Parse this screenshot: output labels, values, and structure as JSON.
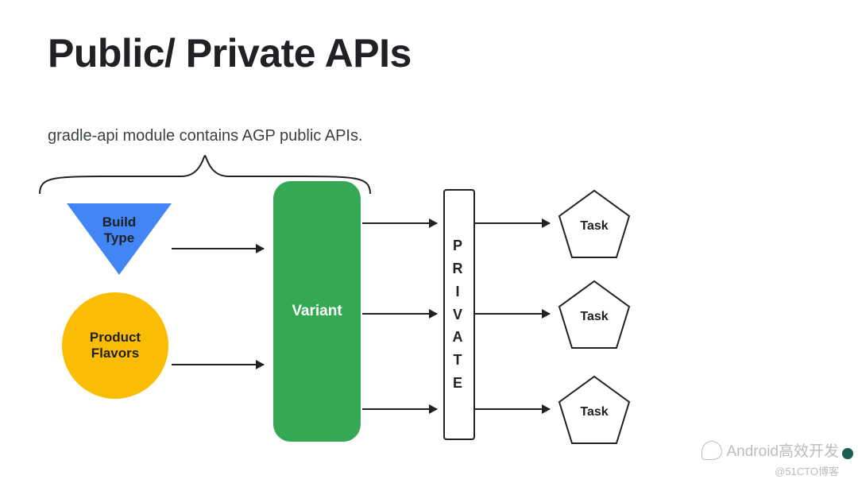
{
  "title": "Public/ Private APIs",
  "subtitle": "gradle-api module contains AGP public APIs.",
  "shapes": {
    "build_type": "Build\nType",
    "product_flavors": "Product\nFlavors",
    "variant": "Variant",
    "private": "PRIVATE",
    "task1": "Task",
    "task2": "Task",
    "task3": "Task"
  },
  "watermark": {
    "account": "Android高效开发",
    "site": "@51CTO博客"
  },
  "colors": {
    "blue": "#4285F4",
    "green": "#34A853",
    "yellow": "#FBBC04",
    "ink": "#202124"
  }
}
